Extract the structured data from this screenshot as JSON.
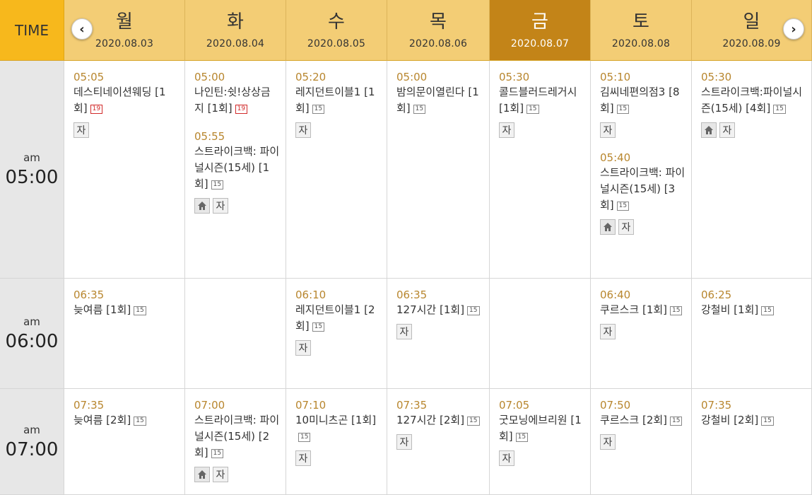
{
  "header": {
    "time_label": "TIME",
    "prev_icon": "chevron-left-icon",
    "next_icon": "chevron-right-icon",
    "prev_glyph": "‹",
    "next_glyph": "›",
    "days": [
      {
        "name": "월",
        "date": "2020.08.03"
      },
      {
        "name": "화",
        "date": "2020.08.04"
      },
      {
        "name": "수",
        "date": "2020.08.05"
      },
      {
        "name": "목",
        "date": "2020.08.06"
      },
      {
        "name": "금",
        "date": "2020.08.07",
        "active": true
      },
      {
        "name": "토",
        "date": "2020.08.08"
      },
      {
        "name": "일",
        "date": "2020.08.09"
      }
    ]
  },
  "colors": {
    "time_header": "#f7b81c",
    "day_header": "#f3cd75",
    "active_day": "#c38418",
    "time_text": "#b8862e"
  },
  "rows": [
    {
      "ampm": "am",
      "time": "05:00",
      "cells": [
        [
          {
            "time": "05:05",
            "title": "데스티네이션웨딩 [1회]",
            "rating": "19",
            "icons": [
              "자"
            ]
          }
        ],
        [
          {
            "time": "05:00",
            "title": "나인틴:쉿!상상금지 [1회]",
            "rating": "19",
            "icons": []
          },
          {
            "time": "05:55",
            "title": "스트라이크백: 파이널시즌(15세) [1회]",
            "rating": "15",
            "icons": [
              "home",
              "자"
            ]
          }
        ],
        [
          {
            "time": "05:20",
            "title": "레지던트이블1 [1회]",
            "rating": "15",
            "icons": [
              "자"
            ]
          }
        ],
        [
          {
            "time": "05:00",
            "title": "밤의문이열린다 [1회]",
            "rating": "15",
            "icons": []
          }
        ],
        [
          {
            "time": "05:30",
            "title": "콜드블러드레거시 [1회]",
            "rating": "15",
            "icons": [
              "자"
            ]
          }
        ],
        [
          {
            "time": "05:10",
            "title": "김씨네편의점3 [8회]",
            "rating": "15",
            "icons": [
              "자"
            ]
          },
          {
            "time": "05:40",
            "title": "스트라이크백: 파이널시즌(15세) [3회]",
            "rating": "15",
            "icons": [
              "home",
              "자"
            ]
          }
        ],
        [
          {
            "time": "05:30",
            "title": "스트라이크백:파이널시즌(15세) [4회]",
            "rating": "15",
            "icons": [
              "home",
              "자"
            ]
          }
        ]
      ]
    },
    {
      "ampm": "am",
      "time": "06:00",
      "cells": [
        [
          {
            "time": "06:35",
            "title": "늦여름 [1회]",
            "rating": "15",
            "icons": []
          }
        ],
        [],
        [
          {
            "time": "06:10",
            "title": "레지던트이블1 [2회]",
            "rating": "15",
            "icons": [
              "자"
            ]
          }
        ],
        [
          {
            "time": "06:35",
            "title": "127시간 [1회]",
            "rating": "15",
            "icons": [
              "자"
            ]
          }
        ],
        [],
        [
          {
            "time": "06:40",
            "title": "쿠르스크 [1회]",
            "rating": "15",
            "icons": [
              "자"
            ]
          }
        ],
        [
          {
            "time": "06:25",
            "title": "강철비 [1회]",
            "rating": "15",
            "icons": []
          }
        ]
      ]
    },
    {
      "ampm": "am",
      "time": "07:00",
      "cells": [
        [
          {
            "time": "07:35",
            "title": "늦여름 [2회]",
            "rating": "15",
            "icons": []
          }
        ],
        [
          {
            "time": "07:00",
            "title": "스트라이크백: 파이널시즌(15세) [2회]",
            "rating": "15",
            "icons": [
              "home",
              "자"
            ]
          }
        ],
        [
          {
            "time": "07:10",
            "title": "10미니츠곤 [1회]",
            "rating": "15",
            "icons": [
              "자"
            ]
          }
        ],
        [
          {
            "time": "07:35",
            "title": "127시간 [2회]",
            "rating": "15",
            "icons": [
              "자"
            ]
          }
        ],
        [
          {
            "time": "07:05",
            "title": "굿모닝에브리원 [1회]",
            "rating": "15",
            "icons": [
              "자"
            ]
          }
        ],
        [
          {
            "time": "07:50",
            "title": "쿠르스크 [2회]",
            "rating": "15",
            "icons": [
              "자"
            ]
          }
        ],
        [
          {
            "time": "07:35",
            "title": "강철비 [2회]",
            "rating": "15",
            "icons": []
          }
        ]
      ]
    }
  ]
}
